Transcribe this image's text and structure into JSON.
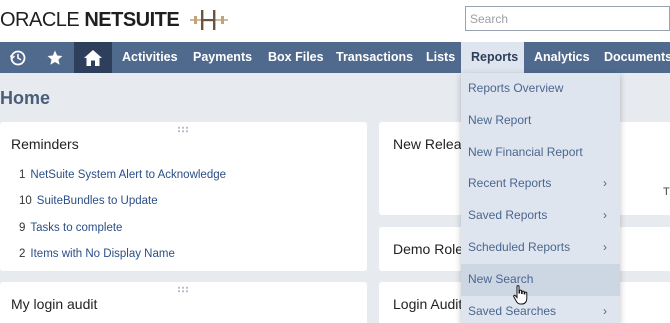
{
  "header": {
    "logo_oracle": "ORACLE",
    "logo_netsuite": "NETSUITE",
    "search_placeholder": "Search"
  },
  "nav": {
    "icons": [
      "recent-records-icon",
      "star-icon",
      "home-icon"
    ],
    "items": [
      {
        "label": "Activities"
      },
      {
        "label": "Payments"
      },
      {
        "label": "Box Files"
      },
      {
        "label": "Transactions"
      },
      {
        "label": "Lists"
      },
      {
        "label": "Reports"
      },
      {
        "label": "Analytics"
      },
      {
        "label": "Documents"
      }
    ],
    "active": "Reports"
  },
  "page": {
    "title": "Home"
  },
  "portlets": {
    "reminders": {
      "title": "Reminders",
      "items": [
        {
          "count": "1",
          "label": "NetSuite System Alert to Acknowledge"
        },
        {
          "count": "10",
          "label": "SuiteBundles to Update"
        },
        {
          "count": "9",
          "label": "Tasks to complete"
        },
        {
          "count": "2",
          "label": "Items with No Display Name"
        }
      ]
    },
    "new_releases": {
      "title": "New Releas"
    },
    "demo_roles": {
      "title": "Demo Roles"
    },
    "login_audit_left": {
      "title": "My login audit"
    },
    "login_audit_right": {
      "title": "Login Audit"
    },
    "right_edge_text": "T"
  },
  "reports_menu": {
    "items": [
      {
        "label": "Reports Overview",
        "has_submenu": false
      },
      {
        "label": "New Report",
        "has_submenu": false
      },
      {
        "label": "New Financial Report",
        "has_submenu": false
      },
      {
        "label": "Recent Reports",
        "has_submenu": true
      },
      {
        "label": "Saved Reports",
        "has_submenu": true
      },
      {
        "label": "Scheduled Reports",
        "has_submenu": true
      },
      {
        "label": "New Search",
        "has_submenu": false
      },
      {
        "label": "Saved Searches",
        "has_submenu": true
      }
    ],
    "hovered": "New Search",
    "chevron": "›"
  }
}
